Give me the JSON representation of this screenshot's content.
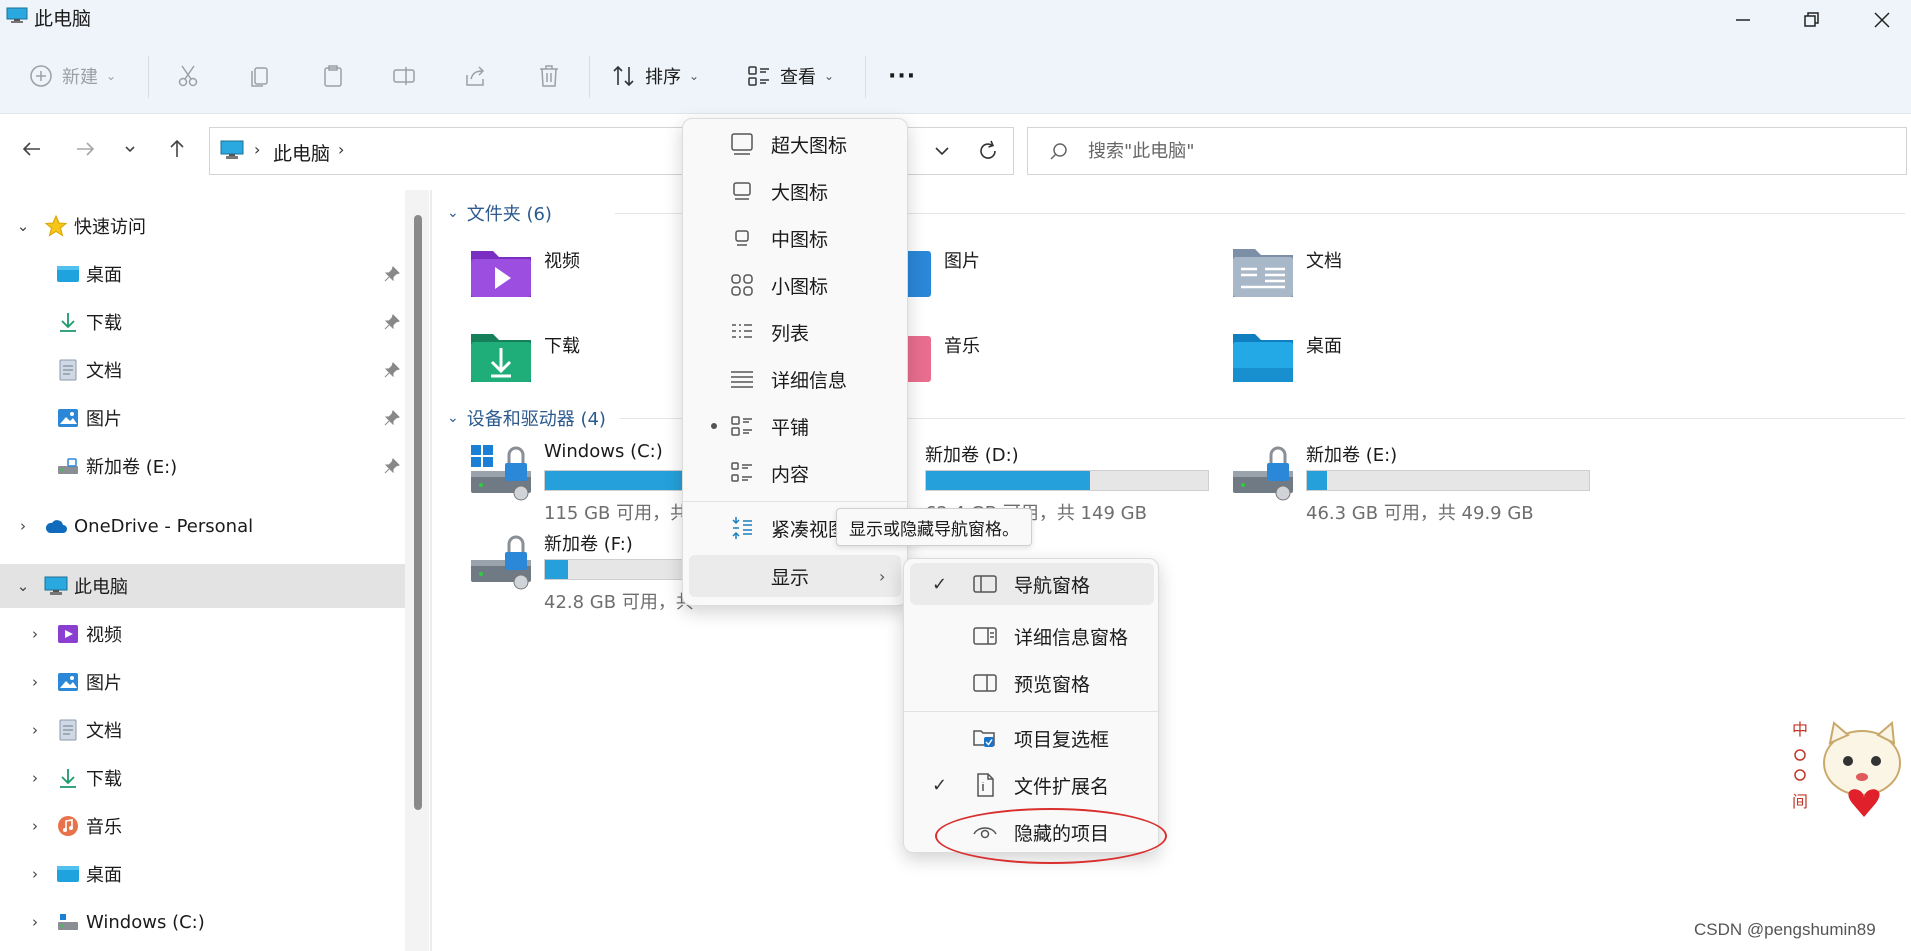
{
  "window": {
    "title": "此电脑"
  },
  "toolbar": {
    "new_label": "新建",
    "sort_label": "排序",
    "view_label": "查看",
    "more_label": "···"
  },
  "address": {
    "path": "此电脑"
  },
  "search": {
    "placeholder": "搜索\"此电脑\""
  },
  "sidebar": {
    "quick_access": "快速访问",
    "quick_items": [
      "桌面",
      "下载",
      "文档",
      "图片",
      "新加卷 (E:)"
    ],
    "onedrive": "OneDrive - Personal",
    "this_pc": "此电脑",
    "pc_items": [
      "视频",
      "图片",
      "文档",
      "下载",
      "音乐",
      "桌面",
      "Windows (C:)"
    ]
  },
  "content": {
    "folders_header": "文件夹 (6)",
    "folders": [
      "视频",
      "图片",
      "文档",
      "下载",
      "音乐",
      "桌面"
    ],
    "drives_header": "设备和驱动器 (4)",
    "drives": [
      {
        "name": "Windows (C:)",
        "info": "115 GB 可用，共",
        "used_fraction": 0.62
      },
      {
        "name": "新加卷 (D:)",
        "info": "62.4 GB 可用，共 149 GB",
        "used_fraction": 0.58
      },
      {
        "name": "新加卷 (E:)",
        "info": "46.3 GB 可用，共 49.9 GB",
        "used_fraction": 0.07
      },
      {
        "name": "新加卷 (F:)",
        "info": "42.8 GB 可用，共",
        "used_fraction": 0.08
      }
    ]
  },
  "view_menu": {
    "items": [
      "超大图标",
      "大图标",
      "中图标",
      "小图标",
      "列表",
      "详细信息",
      "平铺",
      "内容",
      "紧凑视图"
    ],
    "selected": "平铺",
    "show": "显示"
  },
  "tooltip": "显示或隐藏导航窗格。",
  "show_menu": {
    "items": [
      "导航窗格",
      "详细信息窗格",
      "预览窗格",
      "项目复选框",
      "文件扩展名",
      "隐藏的项目"
    ],
    "checked": [
      "导航窗格",
      "文件扩展名"
    ]
  },
  "watermark": "CSDN @pengshumin89",
  "colors": {
    "accent": "#26a0da",
    "folder_header": "#2c5a8f",
    "highlight_circle": "#d9302e"
  }
}
